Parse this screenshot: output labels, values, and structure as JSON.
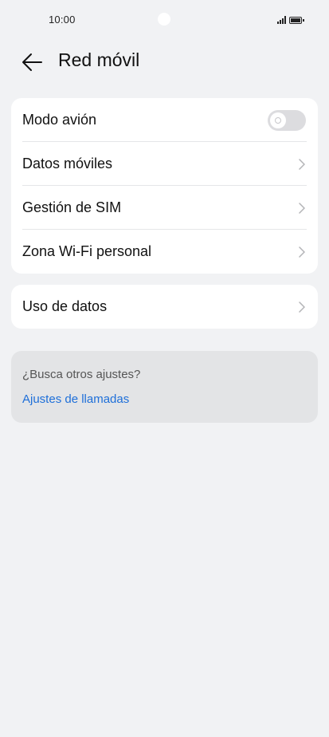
{
  "status_bar": {
    "time": "10:00"
  },
  "header": {
    "title": "Red móvil",
    "back_icon": "arrow-left-icon"
  },
  "network_settings": {
    "airplane_mode": {
      "label": "Modo avión",
      "enabled": false
    },
    "items": [
      {
        "label": "Datos móviles",
        "icon": "chevron-right-icon"
      },
      {
        "label": "Gestión de SIM",
        "icon": "chevron-right-icon"
      },
      {
        "label": "Zona Wi-Fi personal",
        "icon": "chevron-right-icon"
      }
    ]
  },
  "data_usage": {
    "label": "Uso de datos",
    "icon": "chevron-right-icon"
  },
  "suggestions": {
    "question": "¿Busca otros ajustes?",
    "link": "Ajustes de llamadas"
  },
  "colors": {
    "background": "#f1f2f4",
    "card": "#ffffff",
    "link": "#1e6fd9",
    "suggestion_panel": "#e3e4e6"
  }
}
